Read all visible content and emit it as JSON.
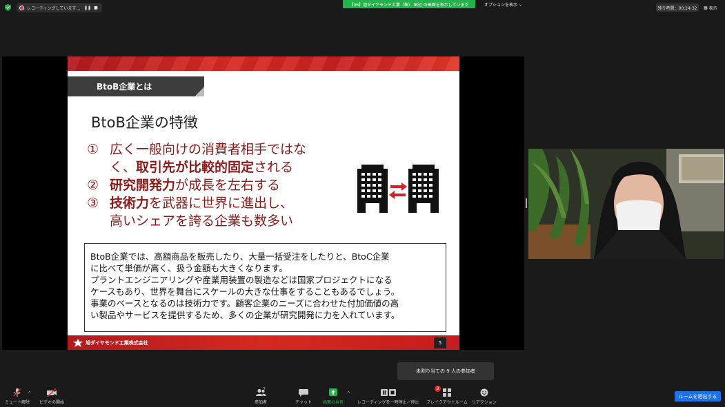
{
  "topbar": {
    "recording_label": "レコーディングしています...",
    "share_banner": "【06】旭ダイヤモンド工業（株） 田辺 の画面を表示しています",
    "options_label": "オプションを表示",
    "timer_text": "残り時間：00:24:32",
    "view_label": "表示"
  },
  "slide": {
    "section_tab": "BtoB企業とは",
    "title": "BtoB企業の特徴",
    "bullets": [
      {
        "num": "①",
        "text_a": "広く一般向けの消費者相手ではな",
        "cont_a": "く、",
        "cont_em": "取引先が比較的固定",
        "cont_b": "される"
      },
      {
        "num": "②",
        "em": "研究開発力",
        "text": "が成長を左右する"
      },
      {
        "num": "③",
        "em": "技術力",
        "text": "を武器に世界に進出し、",
        "cont": "高いシェアを誇る企業も数多い"
      }
    ],
    "description": [
      "BtoB企業では、高額商品を販売したり、大量一括受注をしたりと、BtoC企業",
      "に比べて単価が高く、扱う金額も大きくなります。",
      "プラントエンジニアリングや産業用装置の製造などは国家プロジェクトになる",
      "ケースもあり、世界を舞台にスケールの大きな仕事をすることもあるでしょう。",
      "事業のベースとなるのは技術力です。顧客企業のニーズに合わせた付加価値の高",
      "い製品やサービスを提供するため、多くの企業が研究開発に力を入れています。"
    ],
    "company": "旭ダイヤモンド工業株式会社",
    "page_number": "5",
    "accent_color": "#8b1a1a",
    "band_color": "#c8211f"
  },
  "toolbar": {
    "unmute": "ミュート解除",
    "start_video": "ビデオの開始",
    "participants": "参加者",
    "participant_count": "7",
    "chat": "チャット",
    "share_screen": "画面の共有",
    "recording_controls": "レコーディングを一時停止／停止",
    "breakout_rooms": "ブレイクアウトルーム",
    "breakout_badge": "9",
    "reactions": "リアクション",
    "leave": "ルームを退出する"
  },
  "tooltip": "未割り当ての 9 人の参加者"
}
